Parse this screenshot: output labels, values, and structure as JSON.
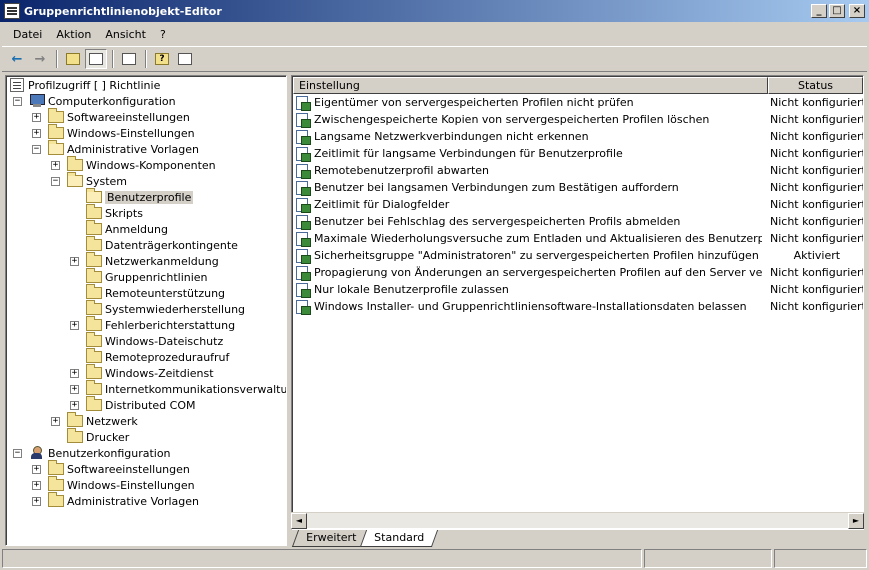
{
  "window": {
    "title": "Gruppenrichtlinienobjekt-Editor",
    "min_label": "_",
    "max_label": "□",
    "close_label": "×"
  },
  "menu": [
    {
      "label": "Datei"
    },
    {
      "label": "Aktion"
    },
    {
      "label": "Ansicht"
    },
    {
      "label": "?"
    }
  ],
  "toolbar": {
    "back_icon": "←",
    "forward_icon": "→",
    "help_icon": "?"
  },
  "tree": {
    "root": "Profilzugriff [                                  ] Richtlinie",
    "items": [
      {
        "label": "Computerkonfiguration",
        "expander": "−"
      },
      {
        "label": "Softwareeinstellungen",
        "expander": "+"
      },
      {
        "label": "Windows-Einstellungen",
        "expander": "+"
      },
      {
        "label": "Administrative Vorlagen",
        "expander": "−"
      },
      {
        "label": "Windows-Komponenten",
        "expander": "+"
      },
      {
        "label": "System",
        "expander": "−"
      },
      {
        "label": "Benutzerprofile",
        "expander": ""
      },
      {
        "label": "Skripts",
        "expander": ""
      },
      {
        "label": "Anmeldung",
        "expander": ""
      },
      {
        "label": "Datenträgerkontingente",
        "expander": ""
      },
      {
        "label": "Netzwerkanmeldung",
        "expander": "+"
      },
      {
        "label": "Gruppenrichtlinien",
        "expander": ""
      },
      {
        "label": "Remoteunterstützung",
        "expander": ""
      },
      {
        "label": "Systemwiederherstellung",
        "expander": ""
      },
      {
        "label": "Fehlerberichterstattung",
        "expander": "+"
      },
      {
        "label": "Windows-Dateischutz",
        "expander": ""
      },
      {
        "label": "Remoteprozeduraufruf",
        "expander": ""
      },
      {
        "label": "Windows-Zeitdienst",
        "expander": "+"
      },
      {
        "label": "Internetkommunikationsverwaltung",
        "expander": "+"
      },
      {
        "label": "Distributed COM",
        "expander": "+"
      },
      {
        "label": "Netzwerk",
        "expander": "+"
      },
      {
        "label": "Drucker",
        "expander": ""
      },
      {
        "label": "Benutzerkonfiguration",
        "expander": "−"
      },
      {
        "label": "Softwareeinstellungen",
        "expander": "+"
      },
      {
        "label": "Windows-Einstellungen",
        "expander": "+"
      },
      {
        "label": "Administrative Vorlagen",
        "expander": "+"
      }
    ]
  },
  "list": {
    "columns": {
      "setting": "Einstellung",
      "status": "Status"
    },
    "rows": [
      {
        "name": "Eigentümer von servergespeicherten Profilen nicht prüfen",
        "status": "Nicht konfiguriert"
      },
      {
        "name": "Zwischengespeicherte Kopien von servergespeicherten Profilen löschen",
        "status": "Nicht konfiguriert"
      },
      {
        "name": "Langsame Netzwerkverbindungen nicht erkennen",
        "status": "Nicht konfiguriert"
      },
      {
        "name": "Zeitlimit für langsame Verbindungen für Benutzerprofile",
        "status": "Nicht konfiguriert"
      },
      {
        "name": "Remotebenutzerprofil abwarten",
        "status": "Nicht konfiguriert"
      },
      {
        "name": "Benutzer bei langsamen Verbindungen zum Bestätigen auffordern",
        "status": "Nicht konfiguriert"
      },
      {
        "name": "Zeitlimit für Dialogfelder",
        "status": "Nicht konfiguriert"
      },
      {
        "name": "Benutzer bei Fehlschlag des servergespeicherten Profils abmelden",
        "status": "Nicht konfiguriert"
      },
      {
        "name": "Maximale Wiederholungsversuche zum Entladen und Aktualisieren des Benutzerprofils",
        "status": "Nicht konfiguriert"
      },
      {
        "name": "Sicherheitsgruppe \"Administratoren\" zu servergespeicherten Profilen hinzufügen",
        "status": "Aktiviert"
      },
      {
        "name": "Propagierung von Änderungen an servergespeicherten Profilen auf den Server verhindern",
        "status": "Nicht konfiguriert"
      },
      {
        "name": "Nur lokale Benutzerprofile zulassen",
        "status": "Nicht konfiguriert"
      },
      {
        "name": "Windows Installer- und Gruppenrichtliniensoftware-Installationsdaten belassen",
        "status": "Nicht konfiguriert"
      }
    ]
  },
  "scrollbar": {
    "left_arrow": "◄",
    "right_arrow": "►"
  },
  "tabs": [
    {
      "label": "Erweitert"
    },
    {
      "label": "Standard"
    }
  ]
}
